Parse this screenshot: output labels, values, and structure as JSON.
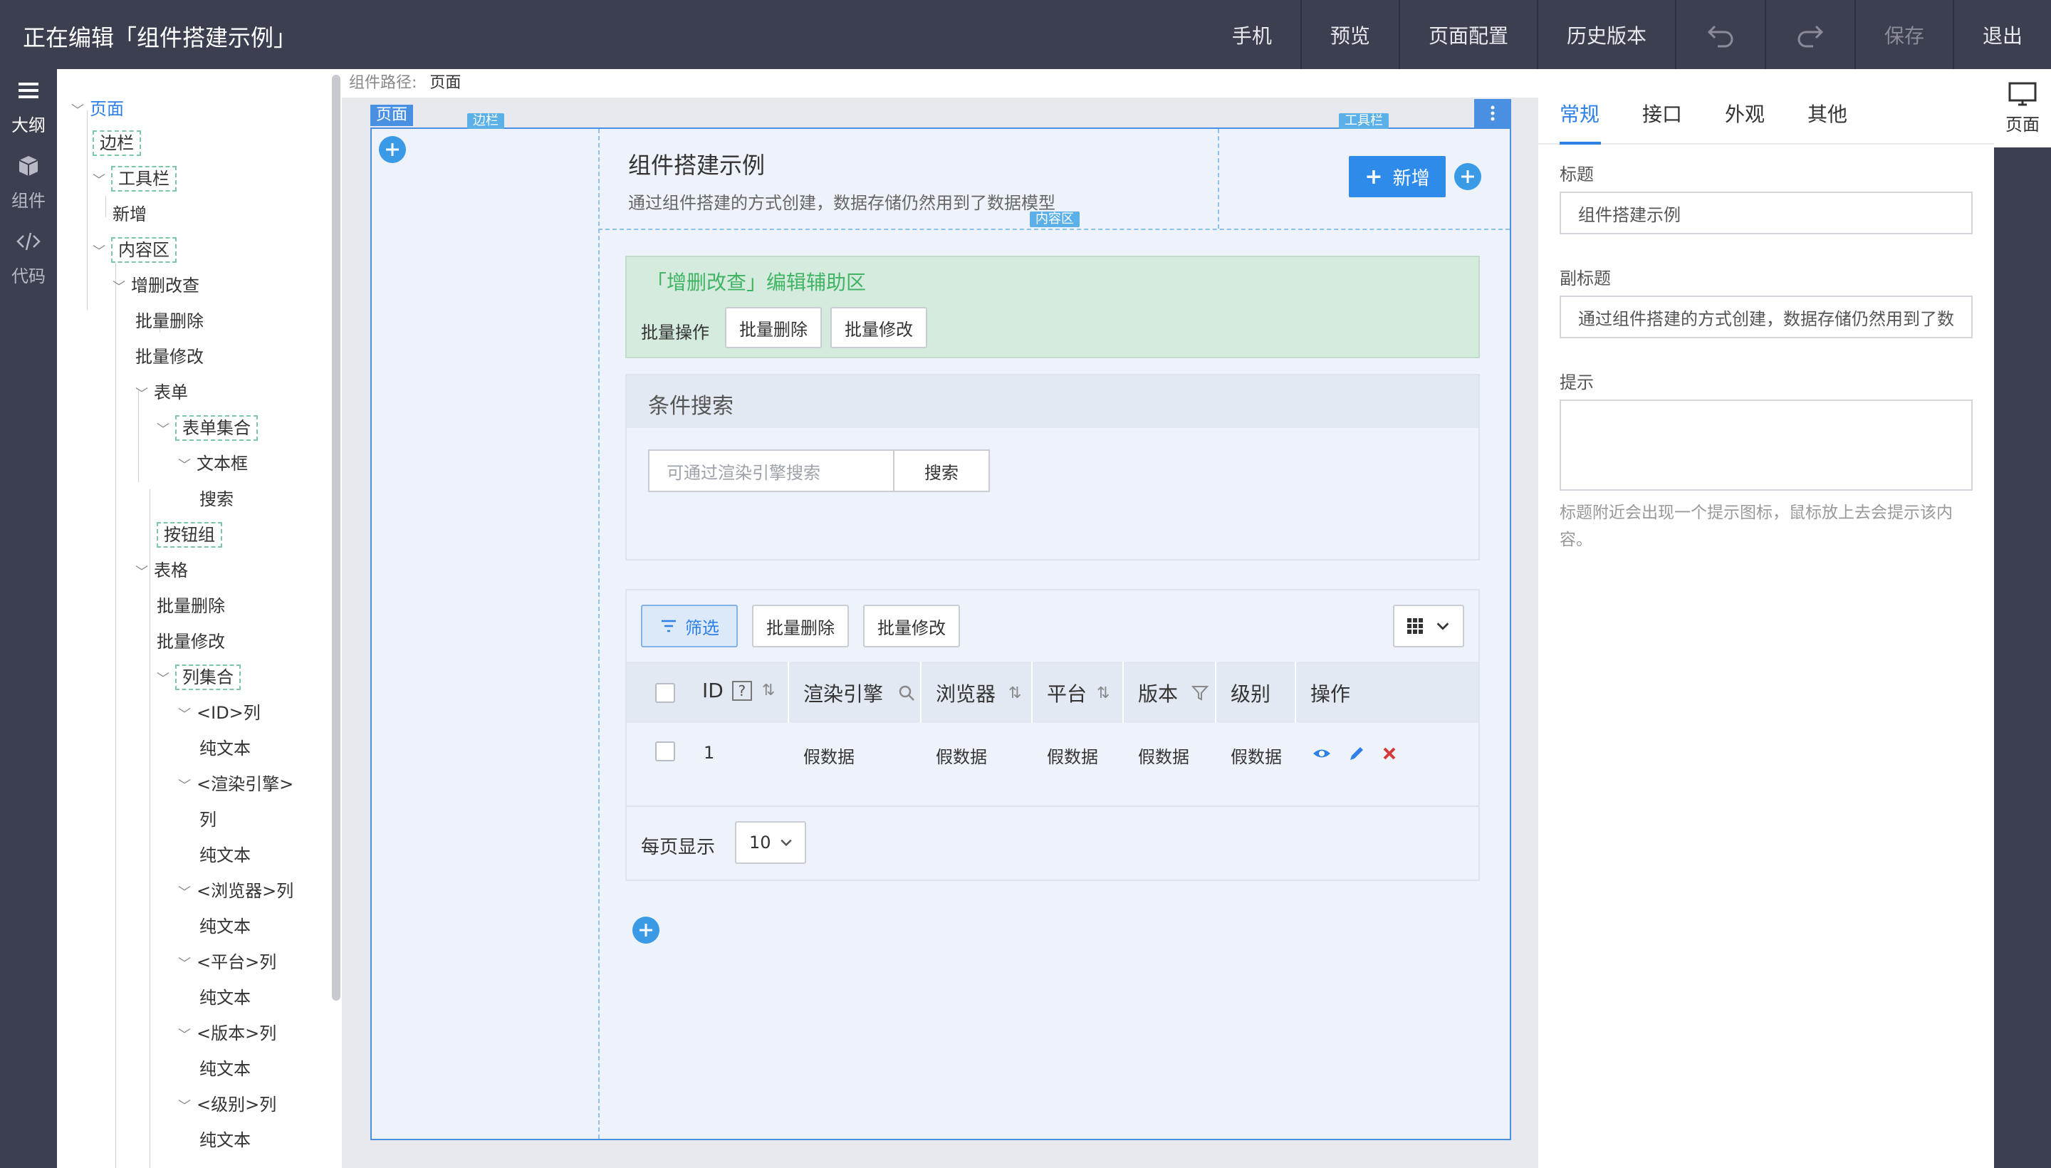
{
  "topbar": {
    "title": "正在编辑「组件搭建示例」",
    "mobile": "手机",
    "preview": "预览",
    "page_config": "页面配置",
    "history": "历史版本",
    "save": "保存",
    "exit": "退出"
  },
  "rail": {
    "outline": "大纲",
    "components": "组件",
    "code": "代码"
  },
  "tree": {
    "page": "页面",
    "sidebar": "边栏",
    "toolbar": "工具栏",
    "add": "新增",
    "content": "内容区",
    "crud": "增删改查",
    "bulk_delete": "批量删除",
    "bulk_edit": "批量修改",
    "form": "表单",
    "form_group": "表单集合",
    "textbox": "文本框",
    "search": "搜索",
    "button_group": "按钮组",
    "table": "表格",
    "table_bulk_delete": "批量删除",
    "table_bulk_edit": "批量修改",
    "columns": "列集合",
    "col_id": "<ID>列",
    "plain1": "纯文本",
    "col_engine_a": "<渲染引擎>",
    "col_engine_b": "列",
    "plain2": "纯文本",
    "col_browser": "<浏览器>列",
    "plain3": "纯文本",
    "col_platform": "<平台>列",
    "plain4": "纯文本",
    "col_version": "<版本>列",
    "plain5": "纯文本",
    "col_grade": "<级别>列",
    "plain6": "纯文本"
  },
  "canvas": {
    "path_label": "组件路径:",
    "path_value": "页面",
    "page_badge": "页面",
    "sidebar_tag": "边栏",
    "toolbar_tag": "工具栏",
    "content_tag": "内容区",
    "title": "组件搭建示例",
    "subtitle": "通过组件搭建的方式创建，数据存储仍然用到了数据模型",
    "add_button": "新增",
    "assist_title": "「增删改查」编辑辅助区",
    "bulk_ops_label": "批量操作",
    "bulk_delete": "批量删除",
    "bulk_edit": "批量修改",
    "search_panel_title": "条件搜索",
    "search_placeholder": "可通过渲染引擎搜索",
    "search_button": "搜索",
    "filter_button": "筛选",
    "table_bulk_delete": "批量删除",
    "table_bulk_edit": "批量修改",
    "columns": [
      "ID",
      "渲染引擎",
      "浏览器",
      "平台",
      "版本",
      "级别",
      "操作"
    ],
    "row": {
      "id": "1",
      "engine": "假数据",
      "browser": "假数据",
      "platform": "假数据",
      "version": "假数据",
      "grade": "假数据"
    },
    "per_page_label": "每页显示",
    "per_page_value": "10"
  },
  "props": {
    "tabs": [
      "常规",
      "接口",
      "外观",
      "其他"
    ],
    "title_label": "标题",
    "title_value": "组件搭建示例",
    "subtitle_label": "副标题",
    "subtitle_value": "通过组件搭建的方式创建，数据存储仍然用到了数",
    "remark_label": "提示",
    "remark_value": "",
    "remark_hint": "标题附近会出现一个提示图标，鼠标放上去会提示该内容。"
  },
  "right_rail": {
    "page": "页面"
  },
  "colors": {
    "topbar": "#3b3f4f",
    "accent": "#2f80e6",
    "assist_bg": "#d5ebde",
    "assist_text": "#3fb463"
  }
}
